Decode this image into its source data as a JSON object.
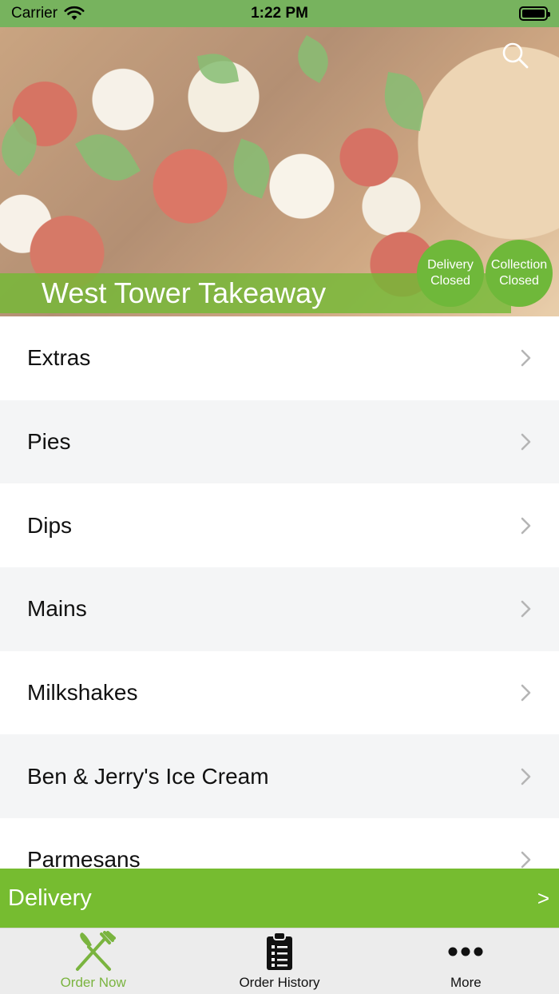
{
  "status_bar": {
    "carrier": "Carrier",
    "time": "1:22 PM",
    "battery_level": 1.0
  },
  "hero": {
    "title": "West Tower Takeaway",
    "badges": {
      "delivery": {
        "line1": "Delivery",
        "line2": "Closed"
      },
      "collection": {
        "line1": "Collection",
        "line2": "Closed"
      }
    },
    "search_icon": "search-icon"
  },
  "menu": {
    "items": [
      {
        "label": "Extras"
      },
      {
        "label": "Pies"
      },
      {
        "label": "Dips"
      },
      {
        "label": "Mains"
      },
      {
        "label": "Milkshakes"
      },
      {
        "label": "Ben & Jerry's Ice Cream"
      },
      {
        "label": "Parmesans"
      }
    ],
    "chevron_icon": "chevron-right-icon"
  },
  "delivery_bar": {
    "label": "Delivery",
    "arrow": ">"
  },
  "tabs": [
    {
      "label": "Order Now",
      "icon": "fork-knife-icon",
      "active": true
    },
    {
      "label": "Order History",
      "icon": "clipboard-list-icon",
      "active": false
    },
    {
      "label": "More",
      "icon": "more-dots-icon",
      "active": false
    }
  ],
  "colors": {
    "status_bar": "#77b35e",
    "brand_green": "#76bc30",
    "active_tab": "#7ab43f",
    "alt_row": "#f4f5f6"
  }
}
